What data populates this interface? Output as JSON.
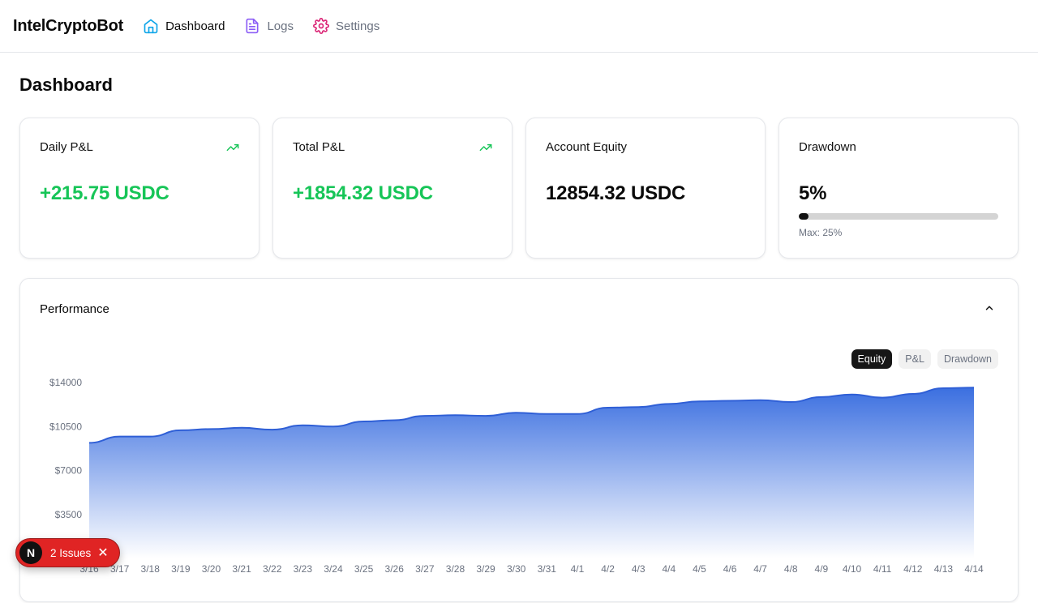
{
  "app": {
    "brand": "IntelCryptoBot"
  },
  "nav": {
    "items": [
      {
        "label": "Dashboard",
        "icon": "home-icon"
      },
      {
        "label": "Logs",
        "icon": "document-icon"
      },
      {
        "label": "Settings",
        "icon": "gear-icon"
      }
    ],
    "active": "Dashboard"
  },
  "page": {
    "title": "Dashboard"
  },
  "cards": {
    "daily_pnl": {
      "label": "Daily P&L",
      "value": "+215.75 USDC",
      "trend": "trending-up-icon"
    },
    "total_pnl": {
      "label": "Total P&L",
      "value": "+1854.32 USDC",
      "trend": "trending-up-icon"
    },
    "equity": {
      "label": "Account Equity",
      "value": "12854.32 USDC"
    },
    "drawdown": {
      "label": "Drawdown",
      "value": "5%",
      "level": 0.05,
      "max_label": "Max: 25%"
    }
  },
  "colors": {
    "positive": "#16c557",
    "accent": "#3b6fe0",
    "issues": "#e02424"
  },
  "performance": {
    "title": "Performance",
    "toggles": [
      "Equity",
      "P&L",
      "Drawdown"
    ],
    "active_toggle": "Equity"
  },
  "chart_data": {
    "type": "area",
    "title": "",
    "xlabel": "",
    "ylabel": "",
    "ylim": [
      0,
      14000
    ],
    "yticks": [
      "$14000",
      "$10500",
      "$7000",
      "$3500"
    ],
    "grid": false,
    "x": [
      "3/16",
      "3/17",
      "3/18",
      "3/19",
      "3/20",
      "3/21",
      "3/22",
      "3/23",
      "3/24",
      "3/25",
      "3/26",
      "3/27",
      "3/28",
      "3/29",
      "3/30",
      "3/31",
      "4/1",
      "4/2",
      "4/3",
      "4/4",
      "4/5",
      "4/6",
      "4/7",
      "4/8",
      "4/9",
      "4/10",
      "4/11",
      "4/12",
      "4/13",
      "4/14"
    ],
    "series": [
      {
        "values": [
          9200,
          9700,
          9700,
          10200,
          10300,
          10400,
          10250,
          10600,
          10500,
          10900,
          11000,
          11350,
          11400,
          11350,
          11600,
          11500,
          11500,
          12000,
          12050,
          12300,
          12500,
          12550,
          12600,
          12450,
          12850,
          13050,
          12800,
          13100,
          13550,
          13600
        ]
      }
    ]
  },
  "issues": {
    "badge": "N",
    "label": "2 Issues"
  }
}
